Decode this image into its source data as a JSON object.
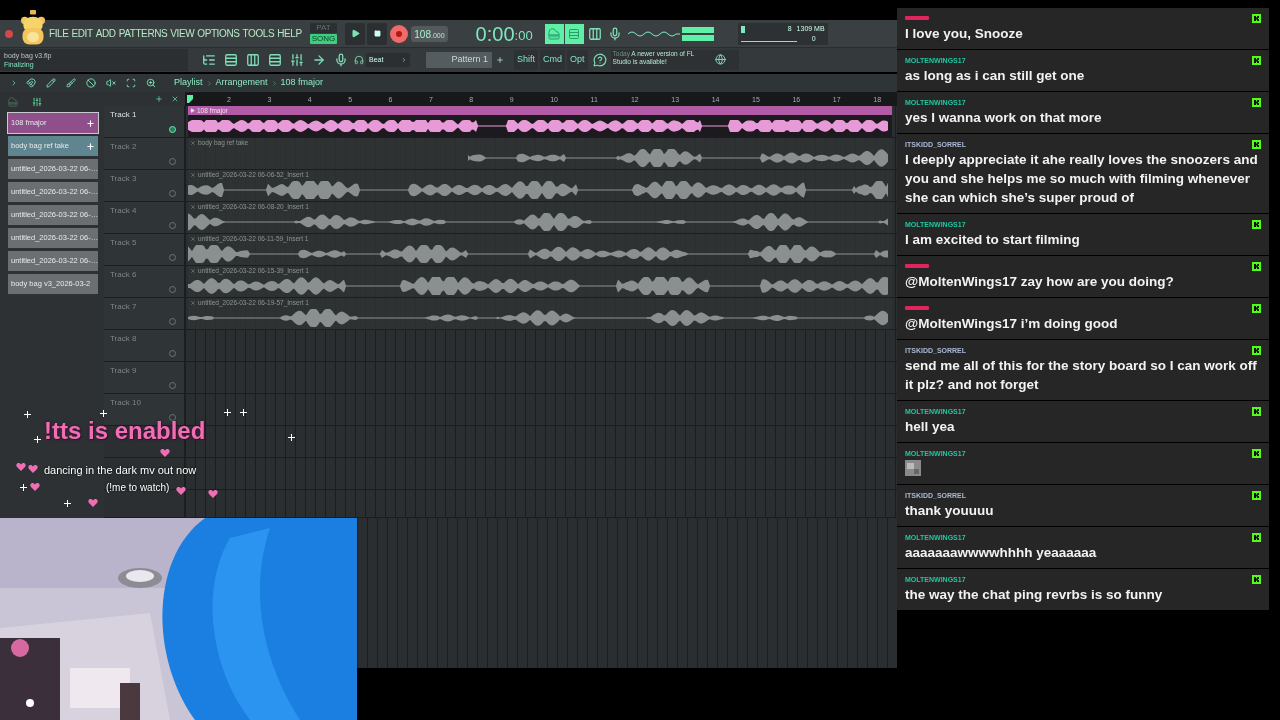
{
  "menu": [
    "FILE",
    "EDIT",
    "ADD",
    "PATTERNS",
    "VIEW",
    "OPTIONS",
    "TOOLS",
    "HELP"
  ],
  "transport": {
    "modes": [
      {
        "label": "PAT",
        "selected": false
      },
      {
        "label": "SONG",
        "selected": true
      }
    ],
    "recording": true,
    "tempo": "108",
    "tempo_fraction": ".000",
    "time": "0:00",
    "time_fraction": ":00"
  },
  "project": {
    "file": "body bag v3.flp",
    "status": "Finalizing"
  },
  "toolbar": {
    "snap": "Beat",
    "pattern": "Pattern 1",
    "keys": [
      "Shift",
      "Cmd",
      "Opt"
    ],
    "hint_day": "Today",
    "hint": "A newer version of FL Studio is available!"
  },
  "monitor": {
    "cpu": "8",
    "memory": "1309 MB",
    "polyphony": "0"
  },
  "playlist": {
    "breadcrumb": [
      "Playlist",
      "Arrangement",
      "108 fmajor"
    ],
    "bars": [
      "2",
      "3",
      "4",
      "5",
      "6",
      "7",
      "8",
      "9",
      "10",
      "11",
      "12",
      "13",
      "14",
      "15",
      "16",
      "17",
      "18"
    ],
    "picker": [
      {
        "name": "108 fmajor",
        "selected": true,
        "color": "#8e4f8a"
      },
      {
        "name": "body bag ref take",
        "selected": false,
        "color": "#5f8590"
      },
      {
        "name": "untitled_2026-03-22 06-…",
        "selected": false,
        "color": "#6b6f72"
      },
      {
        "name": "untitled_2026-03-22 06-…",
        "selected": false,
        "color": "#6b6f72"
      },
      {
        "name": "untitled_2026-03-22 06-…",
        "selected": false,
        "color": "#6b6f72"
      },
      {
        "name": "untitled_2026-03-22 06-…",
        "selected": false,
        "color": "#6b6f72"
      },
      {
        "name": "untitled_2026-03-22 06-…",
        "selected": false,
        "color": "#6b6f72"
      },
      {
        "name": "body bag v3_2026-03-2",
        "selected": false,
        "color": "#6b6f72"
      }
    ],
    "tracks": [
      {
        "name": "Track 1",
        "active": true,
        "clip": {
          "name": "108 fmajor",
          "kind": "pattern"
        }
      },
      {
        "name": "Track 2",
        "active": false,
        "clip": {
          "name": "body bag ref take",
          "kind": "audio"
        }
      },
      {
        "name": "Track 3",
        "active": false,
        "clip": {
          "name": "untitled_2026-03-22 06-06-52_Insert 1",
          "kind": "audio"
        }
      },
      {
        "name": "Track 4",
        "active": false,
        "clip": {
          "name": "untitled_2026-03-22 06-08-20_Insert 1",
          "kind": "audio"
        }
      },
      {
        "name": "Track 5",
        "active": false,
        "clip": {
          "name": "untitled_2026-03-22 06-11-59_Insert 1",
          "kind": "audio"
        }
      },
      {
        "name": "Track 6",
        "active": false,
        "clip": {
          "name": "untitled_2026-03-22 06-15-39_Insert 1",
          "kind": "audio"
        }
      },
      {
        "name": "Track 7",
        "active": false,
        "clip": {
          "name": "untitled_2026-03-22 06-19-57_Insert 1",
          "kind": "audio"
        }
      },
      {
        "name": "Track 8",
        "active": false
      },
      {
        "name": "Track 9",
        "active": false
      },
      {
        "name": "Track 10",
        "active": false
      }
    ]
  },
  "overlay": {
    "title": "!tts is enabled",
    "line": "dancing in the dark mv out now",
    "hint": "(!me to watch)"
  },
  "chat": [
    {
      "color": "#e0245e",
      "text": "I love you, Snooze",
      "kind": "text"
    },
    {
      "user": "MOLTENWINGS17",
      "color": "#1fc7a0",
      "text": "as long as i can still get one",
      "kind": "text"
    },
    {
      "user": "MOLTENWINGS17",
      "color": "#1fc7a0",
      "text": "yes I wanna work on that more",
      "kind": "text"
    },
    {
      "user": "ITSKIDD_SORREL",
      "color": "#a9b8d6",
      "text": "I deeply appreciate it ahe really loves the snoozers and you and she helps me so much with filming whenever she can which she’s super proud of",
      "kind": "text"
    },
    {
      "user": "MOLTENWINGS17",
      "color": "#1fc7a0",
      "text": "I am excited to start filming",
      "kind": "text"
    },
    {
      "color": "#e0245e",
      "text": "@MoltenWings17 zay how are you doing?",
      "kind": "text"
    },
    {
      "color": "#e0245e",
      "text": "@MoltenWings17 i’m doing good",
      "kind": "text"
    },
    {
      "user": "ITSKIDD_SORREL",
      "color": "#a9b8d6",
      "text": "send me all of this for the story board so I can work off it plz? and not forget",
      "kind": "text"
    },
    {
      "user": "MOLTENWINGS17",
      "color": "#1fc7a0",
      "text": "hell yea",
      "kind": "text"
    },
    {
      "user": "MOLTENWINGS17",
      "color": "#1fc7a0",
      "kind": "emote"
    },
    {
      "user": "ITSKIDD_SORREL",
      "color": "#a9b8d6",
      "text": "thank youuuu",
      "kind": "text"
    },
    {
      "user": "MOLTENWINGS17",
      "color": "#1fc7a0",
      "text": "aaaaaaawwwwhhhh yeaaaaaa",
      "kind": "text"
    },
    {
      "user": "MOLTENWINGS17",
      "color": "#1fc7a0",
      "text": "the way the chat ping revrbs is so funny",
      "kind": "text"
    }
  ]
}
